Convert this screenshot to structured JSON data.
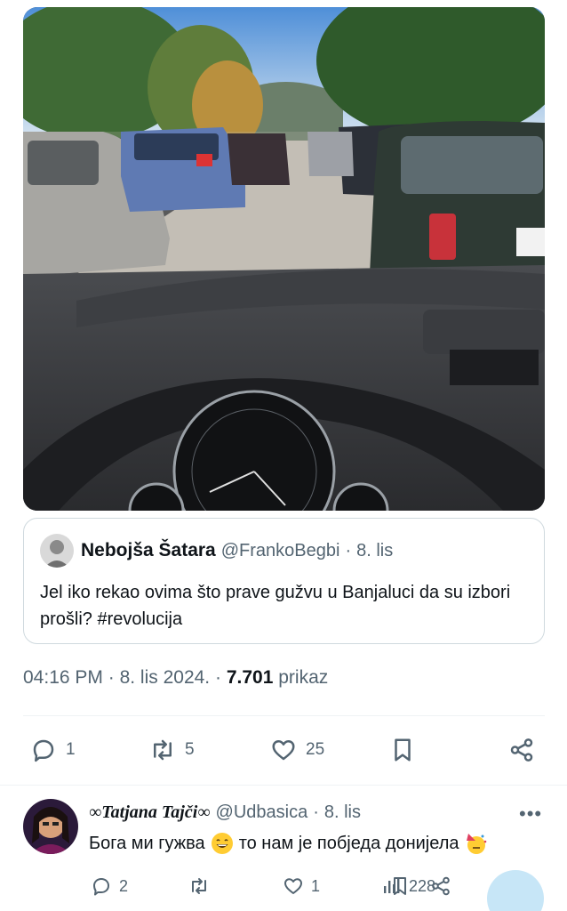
{
  "quoted_tweet": {
    "name": "Nebojša Šatara",
    "handle": "@FrankoBegbi",
    "separator": "·",
    "date": "8. lis",
    "text": "Jel iko rekao ovima što prave gužvu u Banjaluci da su izbori prošli? #revolucija"
  },
  "meta": {
    "time": "04:16 PM",
    "sep1": "·",
    "date": "8. lis 2024.",
    "sep2": "·",
    "views": "7.701",
    "views_label": "prikaz"
  },
  "actions": {
    "replies": "1",
    "reposts": "5",
    "likes": "25",
    "reply_icon": "reply-icon",
    "repost_icon": "repost-icon",
    "like_icon": "heart-icon",
    "bookmark_icon": "bookmark-icon",
    "share_icon": "share-icon"
  },
  "reply": {
    "name": "∞Tatjana Tajči∞",
    "handle": "@Udbasica",
    "separator": "·",
    "date": "8. lis",
    "text_part1": "Бога ми гужва",
    "text_part2": "то нам је побједа донијела",
    "more": "•••",
    "replies": "2",
    "reposts": "",
    "likes": "1",
    "views": "228"
  },
  "colors": {
    "text": "#0f1419",
    "secondary": "#536471",
    "border": "#cfd9de",
    "divider": "#eff3f4"
  }
}
